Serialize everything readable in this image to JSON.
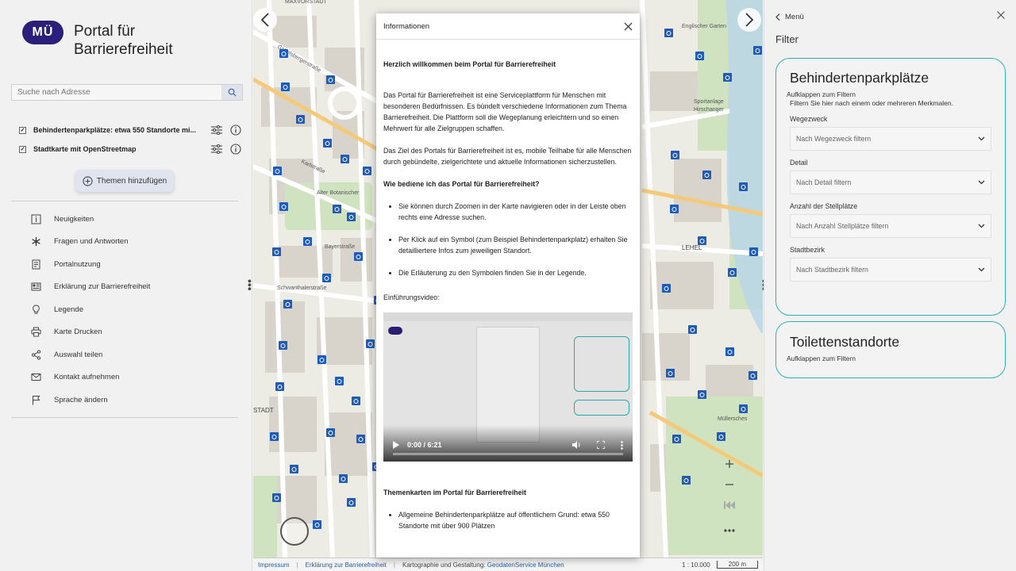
{
  "sidebar": {
    "logo_text": "MÜ",
    "title": "Portal für Barrierefreiheit",
    "search_placeholder": "Suche nach Adresse",
    "layers": [
      {
        "label": "Behindertenparkplätze: etwa 550 Standorte mi..."
      },
      {
        "label": "Stadtkarte mit OpenStreetmap"
      }
    ],
    "add_topics_label": "Themen hinzufügen",
    "menu": [
      {
        "label": "Neuigkeiten",
        "icon": "info-icon"
      },
      {
        "label": "Fragen und Antworten",
        "icon": "asterisk-icon"
      },
      {
        "label": "Portalnutzung",
        "icon": "document-icon"
      },
      {
        "label": "Erklärung zur Barrierefreiheit",
        "icon": "newspaper-icon"
      },
      {
        "label": "Legende",
        "icon": "lightbulb-icon"
      },
      {
        "label": "Karte Drucken",
        "icon": "printer-icon"
      },
      {
        "label": "Auswahl teilen",
        "icon": "share-icon"
      },
      {
        "label": "Kontakt aufnehmen",
        "icon": "envelope-icon"
      },
      {
        "label": "Sprache ändern",
        "icon": "flag-icon"
      }
    ]
  },
  "modal": {
    "title": "Informationen",
    "welcome": "Herzlich willkommen beim Portal für Barrierefreiheit",
    "para1": "Das Portal für Barrierefreiheit ist eine Serviceplattform für Menschen mit besonderen Bedürfnissen. Es bündelt verschiedene Informationen zum Thema Barrierefreiheit. Die Plattform soll die Wegeplanung erleichtern und so einen Mehrwert für alle Zielgruppen schaffen.",
    "para2": "Das Ziel des Portals für Barrierefreiheit ist es, mobile Teilhabe für alle Menschen durch gebündelte, zielgerichtete und aktuelle Informationen sicherzustellen.",
    "howto_heading": "Wie bediene ich das Portal für Barrierefreiheit?",
    "howto_items": [
      "Sie können durch Zoomen in der Karte navigieren oder in der Leiste oben rechts eine Adresse suchen.",
      "Per Klick auf ein Symbol (zum Beispiel Behindertenparkplatz) erhalten Sie detailliertere Infos zum jeweiligen Standort.",
      "Die Erläuterung zu den Symbolen finden Sie in der Legende."
    ],
    "video_label": "Einführungsvideo:",
    "video_time": "0:00 / 6:21",
    "video_progress": 0.0,
    "topics_heading": "Themenkarten im Portal für Barrierefreiheit",
    "topics_items": [
      "Allgemeine Behindertenparkplätze auf öffentlichem Grund: etwa 550 Standorte mit über 900 Plätzen"
    ]
  },
  "map_footer": {
    "impressum": "Impressum",
    "erklaerung": "Erklärung zur Barrierefreiheit",
    "credit_prefix": "Kartographie und Gestaltung:",
    "credit_link": "GeodatenService München",
    "scale_ratio": "1 : 10.000",
    "scale_bar": "200 m"
  },
  "right_panel": {
    "back_label": "Menü",
    "filter_title": "Filter",
    "card1": {
      "title": "Behindertenparkplätze",
      "expand_hint": "Aufklappen zum Filtern",
      "description": "Filtern Sie hier nach einem oder mehreren Merkmalen.",
      "fields": [
        {
          "label": "Wegezweck",
          "placeholder": "Nach Wegezweck filtern"
        },
        {
          "label": "Detail",
          "placeholder": "Nach Detail filtern"
        },
        {
          "label": "Anzahl der Stellplätze",
          "placeholder": "Nach Anzahl Stellplätze filtern"
        },
        {
          "label": "Stadtbezirk",
          "placeholder": "Nach Stadtbezirk filtern"
        }
      ]
    },
    "card2": {
      "title": "Toilettenstandorte",
      "expand_hint": "Aufklappen zum Filtern"
    }
  },
  "colors": {
    "accent_teal": "#2bb3b3",
    "logo_purple": "#2a1f7a",
    "parking_blue": "#1f5cb8"
  }
}
